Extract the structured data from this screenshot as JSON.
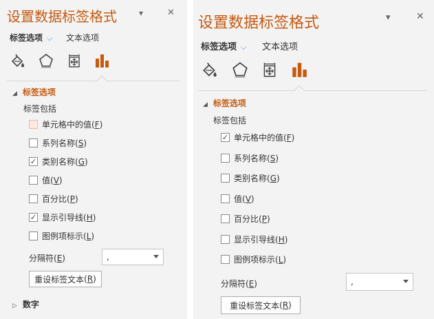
{
  "left": {
    "title": "设置数据标签格式",
    "dropdown_glyph": "▾",
    "close_glyph": "✕",
    "tabs": {
      "label_options": "标签选项",
      "text_options": "文本选项",
      "chevron": "⌵"
    },
    "icons": [
      "fill-bucket-icon",
      "pentagon-effects-icon",
      "size-properties-icon",
      "bar-chart-icon"
    ],
    "section_label_options": "标签选项",
    "label_contains": "标签包括",
    "options": [
      {
        "text": "单元格中的值",
        "key": "F",
        "checked": false,
        "highlight": true
      },
      {
        "text": "系列名称",
        "key": "S",
        "checked": false,
        "highlight": false
      },
      {
        "text": "类别名称",
        "key": "G",
        "checked": true,
        "highlight": false
      },
      {
        "text": "值",
        "key": "V",
        "checked": false,
        "highlight": false
      },
      {
        "text": "百分比",
        "key": "P",
        "checked": false,
        "highlight": false
      },
      {
        "text": "显示引导线",
        "key": "H",
        "checked": true,
        "highlight": false
      },
      {
        "text": "图例项标示",
        "key": "L",
        "checked": false,
        "highlight": false
      }
    ],
    "separator": {
      "label": "分隔符",
      "key": "E",
      "value": ","
    },
    "reset_button": {
      "text": "重设标签文本",
      "key": "R"
    },
    "section_number": "数字"
  },
  "right": {
    "title": "设置数据标签格式",
    "dropdown_glyph": "▾",
    "close_glyph": "✕",
    "tabs": {
      "label_options": "标签选项",
      "text_options": "文本选项",
      "chevron": "⌵"
    },
    "icons": [
      "fill-bucket-icon",
      "pentagon-effects-icon",
      "size-properties-icon",
      "bar-chart-icon"
    ],
    "section_label_options": "标签选项",
    "label_contains": "标签包括",
    "options": [
      {
        "text": "单元格中的值",
        "key": "F",
        "checked": true,
        "highlight": false
      },
      {
        "text": "系列名称",
        "key": "S",
        "checked": false,
        "highlight": false
      },
      {
        "text": "类别名称",
        "key": "G",
        "checked": false,
        "highlight": false
      },
      {
        "text": "值",
        "key": "V",
        "checked": false,
        "highlight": false
      },
      {
        "text": "百分比",
        "key": "P",
        "checked": false,
        "highlight": false
      },
      {
        "text": "显示引导线",
        "key": "H",
        "checked": false,
        "highlight": false
      },
      {
        "text": "图例项标示",
        "key": "L",
        "checked": false,
        "highlight": false
      }
    ],
    "separator": {
      "label": "分隔符",
      "key": "E",
      "value": ","
    },
    "reset_button": {
      "text": "重设标签文本",
      "key": "R"
    }
  },
  "colors": {
    "accent": "#c55a11",
    "chevron": "#2b7cd3",
    "panel_bg": "#f3f3f3",
    "checkbox_highlight": "#fde9e1"
  },
  "check_glyph": "✓",
  "section_expanded_glyph": "◢",
  "section_collapsed_glyph": "▷"
}
